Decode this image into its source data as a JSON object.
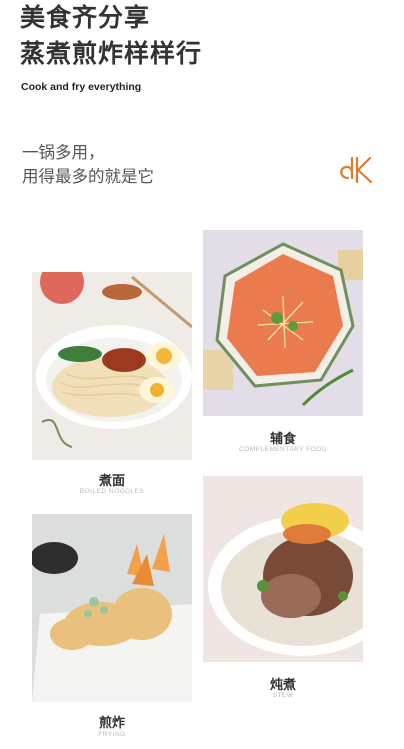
{
  "header": {
    "title_line1": "美食齐分享",
    "title_line2": "蒸煮煎炸样样行",
    "subtitle": "Cook and fry everything"
  },
  "slogan": {
    "line1": "一锅多用，",
    "line2": "用得最多的就是它"
  },
  "brand": {
    "logo_icon": "dk-logo-icon",
    "color": "#e07a2f"
  },
  "foods": [
    {
      "title": "煮面",
      "en": "BOILED NOODLES"
    },
    {
      "title": "辅食",
      "en": "COMPLEMENTARY FOOD"
    },
    {
      "title": "煎炸",
      "en": "FRYING"
    },
    {
      "title": "炖煮",
      "en": "STEW"
    }
  ]
}
